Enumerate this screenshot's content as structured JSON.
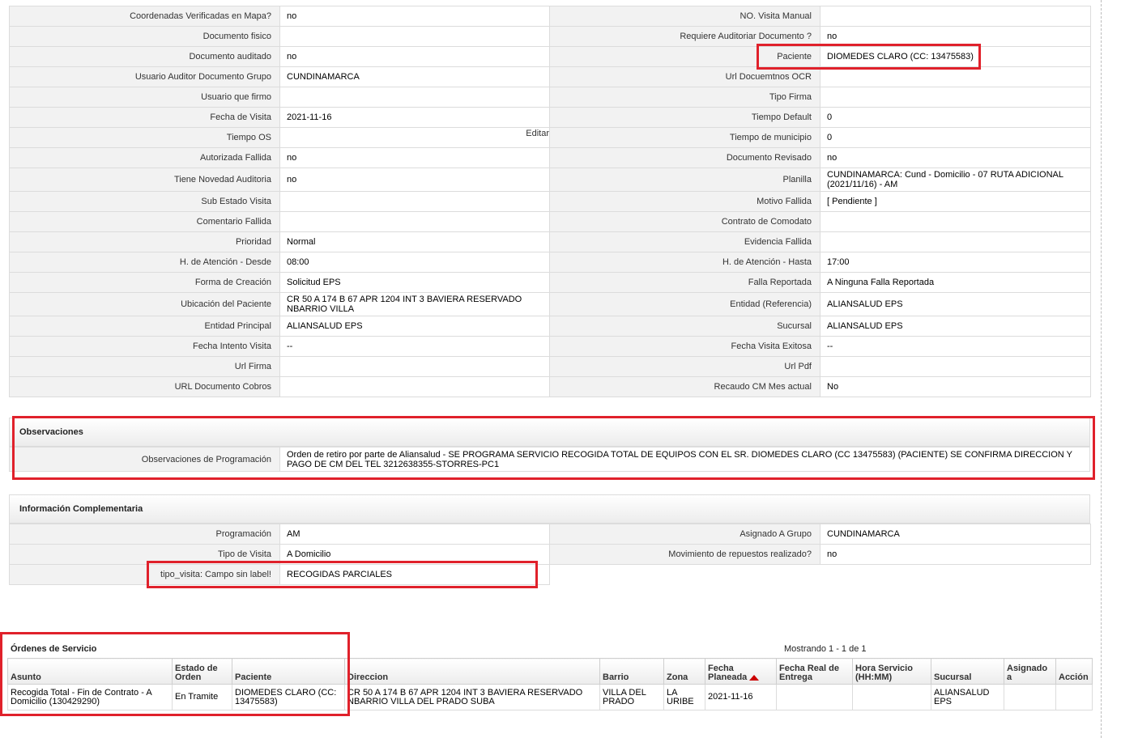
{
  "detail_rows": [
    {
      "l1": "Coordenadas Verificadas en Mapa?",
      "v1": "no",
      "l2": "NO. Visita Manual",
      "v2": ""
    },
    {
      "l1": "Documento fisico",
      "v1": "",
      "l2": "Requiere Auditoriar Documento ?",
      "v2": "no"
    },
    {
      "l1": "Documento auditado",
      "v1": "no",
      "l2": "Paciente",
      "v2": "DIOMEDES CLARO (CC: 13475583)"
    },
    {
      "l1": "Usuario Auditor Documento Grupo",
      "v1": "CUNDINAMARCA",
      "l2": "Url Docuemtnos OCR",
      "v2": ""
    },
    {
      "l1": "Usuario que firmo",
      "v1": "",
      "l2": "Tipo Firma",
      "v2": ""
    },
    {
      "l1": "Fecha de Visita",
      "v1": "2021-11-16",
      "l2": "Tiempo Default",
      "v2": "0"
    },
    {
      "l1": "Tiempo OS",
      "v1": "",
      "l2": "Tiempo de municipio",
      "v2": "0"
    },
    {
      "l1": "Autorizada Fallida",
      "v1": "no",
      "l2": "Documento Revisado",
      "v2": "no"
    },
    {
      "l1": "Tiene Novedad Auditoria",
      "v1": "no",
      "l2": "Planilla",
      "v2": "CUNDINAMARCA: Cund - Domicilio - 07 RUTA ADICIONAL (2021/11/16) - AM"
    },
    {
      "l1": "Sub Estado Visita",
      "v1": "",
      "l2": "Motivo Fallida",
      "v2": "[ Pendiente ]"
    },
    {
      "l1": "Comentario Fallida",
      "v1": "",
      "l2": "Contrato de Comodato",
      "v2": ""
    },
    {
      "l1": "Prioridad",
      "v1": "Normal",
      "l2": "Evidencia Fallida",
      "v2": ""
    },
    {
      "l1": "H. de Atención - Desde",
      "v1": "08:00",
      "l2": "H. de Atención - Hasta",
      "v2": "17:00"
    },
    {
      "l1": "Forma de Creación",
      "v1": "Solicitud EPS",
      "l2": "Falla Reportada",
      "v2": "A Ninguna Falla Reportada"
    },
    {
      "l1": "Ubicación del Paciente",
      "v1": "CR 50 A 174 B 67 APR 1204 INT 3 BAVIERA RESERVADO NBARRIO VILLA",
      "l2": "Entidad (Referencia)",
      "v2": "ALIANSALUD EPS"
    },
    {
      "l1": "Entidad Principal",
      "v1": "ALIANSALUD EPS",
      "l2": "Sucursal",
      "v2": "ALIANSALUD EPS"
    },
    {
      "l1": "Fecha Intento Visita",
      "v1": "--",
      "l2": "Fecha Visita Exitosa",
      "v2": "--"
    },
    {
      "l1": "Url Firma",
      "v1": "",
      "l2": "Url Pdf",
      "v2": ""
    },
    {
      "l1": "URL Documento Cobros",
      "v1": "",
      "l2": "Recaudo CM Mes actual",
      "v2": "No"
    }
  ],
  "edit_label": "Editar",
  "observaciones": {
    "title": "Observaciones",
    "label": "Observaciones de Programación",
    "text": "Orden de retiro por parte de Aliansalud - SE PROGRAMA SERVICIO RECOGIDA TOTAL DE EQUIPOS CON EL SR. DIOMEDES CLARO (CC 13475583) (PACIENTE) SE CONFIRMA DIRECCION Y PAGO DE CM DEL TEL 3212638355-STORRES-PC1"
  },
  "complementaria": {
    "title": "Información Complementaria",
    "rows": [
      {
        "l1": "Programación",
        "v1": "AM",
        "l2": "Asignado A Grupo",
        "v2": "CUNDINAMARCA"
      },
      {
        "l1": "Tipo de Visita",
        "v1": "A Domicilio",
        "l2": "Movimiento de repuestos realizado?",
        "v2": "no"
      }
    ],
    "last": {
      "l1": "tipo_visita: Campo sin label!",
      "v1": "RECOGIDAS PARCIALES"
    }
  },
  "ordenes": {
    "title": "Órdenes de Servicio",
    "count": "Mostrando 1 - 1 de 1",
    "columns": [
      "Asunto",
      "Estado de Orden",
      "Paciente",
      "Direccion",
      "Barrio",
      "Zona",
      "Fecha Planeada",
      "Fecha Real de Entrega",
      "Hora Servicio (HH:MM)",
      "Sucursal",
      "Asignado a",
      "Acción"
    ],
    "rows": [
      [
        "Recogida Total - Fin de Contrato - A Domicilio (130429290)",
        "En Tramite",
        "DIOMEDES CLARO (CC: 13475583)",
        "CR 50 A 174 B 67 APR 1204 INT 3 BAVIERA RESERVADO NBARRIO VILLA DEL PRADO SUBA",
        "VILLA DEL PRADO",
        "LA URIBE",
        "2021-11-16",
        "",
        "",
        "ALIANSALUD EPS",
        "",
        ""
      ]
    ]
  },
  "colors": {
    "highlight": "#e0212b",
    "label_bg": "#f2f2f2",
    "border": "#dcdcdc"
  }
}
